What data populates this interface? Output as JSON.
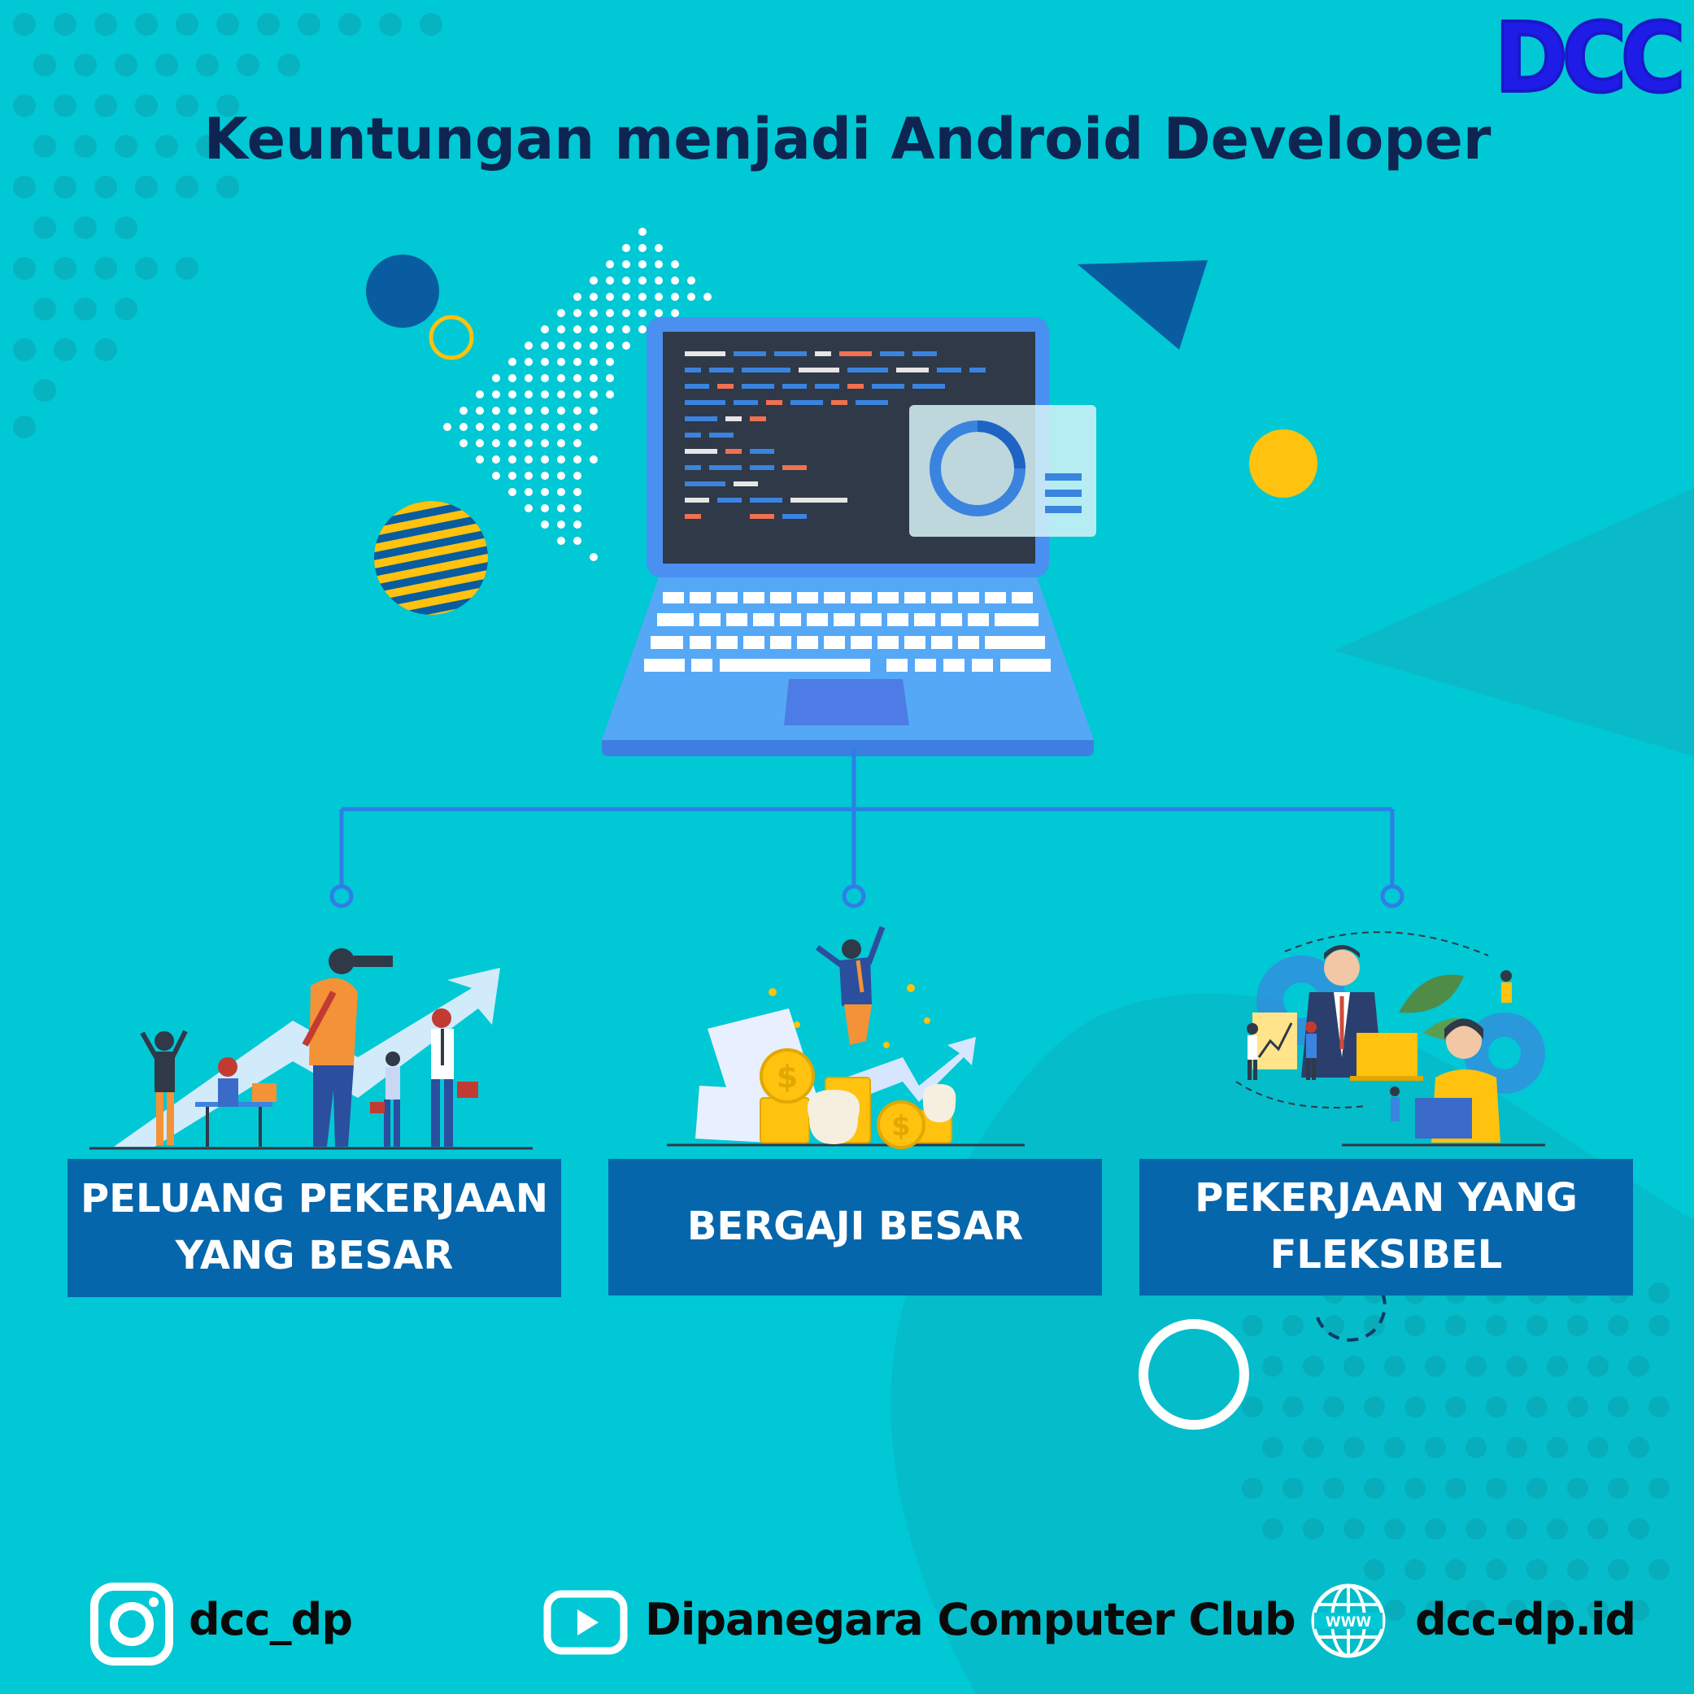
{
  "header": {
    "title": "Keuntungan menjadi Android Developer",
    "logo_text": "DCC"
  },
  "benefits": [
    {
      "line1": "PELUANG PEKERJAAN",
      "line2": "YANG BESAR",
      "icon": "career-growth-illustration"
    },
    {
      "line1": "BERGAJI BESAR",
      "line2": "",
      "icon": "money-coins-illustration"
    },
    {
      "line1": "PEKERJAAN YANG",
      "line2": "FLEKSIBEL",
      "icon": "flexible-work-illustration"
    }
  ],
  "footer": {
    "instagram": "dcc_dp",
    "youtube": "Dipanegara Computer Club",
    "website": "dcc-dp.id",
    "www_label": "WWW"
  },
  "colors": {
    "background": "#00C8D4",
    "title": "#0E2451",
    "box": "#0566AC",
    "logo": "#1E1CE6",
    "accent_yellow": "#FFC20E",
    "laptop_blue": "#4A90F0"
  }
}
